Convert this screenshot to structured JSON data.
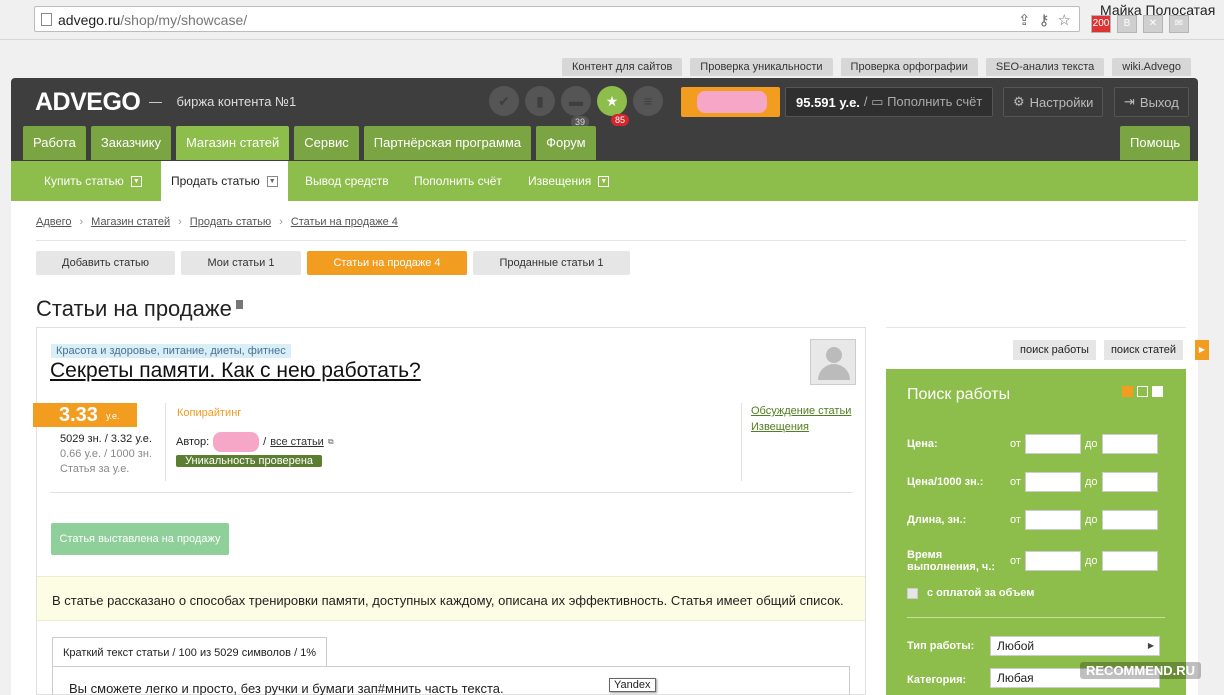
{
  "browser": {
    "url_domain": "advego.ru",
    "url_path": "/shop/my/showcase/",
    "user_name": "Майка Полосатая",
    "ext_badge": "200"
  },
  "top_links": [
    "Контент для сайтов",
    "Проверка уникальности",
    "Проверка орфографии",
    "SEO-анализ текста",
    "wiki.Advego"
  ],
  "header": {
    "logo": "ADVEGO",
    "slogan_dash": "—",
    "slogan": "биржа контента №1",
    "badge_folder": "39",
    "badge_star": "85",
    "balance": "95.591 у.е.",
    "topup": "Пополнить счёт",
    "settings": "Настройки",
    "logout": "Выход"
  },
  "main_nav": [
    "Работа",
    "Заказчику",
    "Магазин статей",
    "Сервис",
    "Партнёрская программа",
    "Форум"
  ],
  "help_tab": "Помощь",
  "sub_nav": {
    "buy": "Купить статью",
    "sell": "Продать статью",
    "withdraw": "Вывод средств",
    "topup": "Пополнить счёт",
    "notices": "Извещения"
  },
  "breadcrumb": [
    "Адвего",
    "Магазин статей",
    "Продать статью",
    "Статьи на продаже 4"
  ],
  "filters": [
    "Добавить статью",
    "Мои статьи 1",
    "Статьи на продаже 4",
    "Проданные статьи 1"
  ],
  "page_title": "Статьи на продаже",
  "article": {
    "category": "Красота и здоровье, питание, диеты, фитнес",
    "title": "Секреты памяти. Как с нею работать?",
    "price": "3.33",
    "price_unit": "у.е.",
    "size_line": "5029 зн. / 3.32 у.е.",
    "per_1000": "0.66 у.е. / 1000 зн.",
    "price_label": "Статья за у.е.",
    "type": "Копирайтинг",
    "author_label": "Автор:",
    "author_sep": "/",
    "all_articles": "все статьи",
    "uniqueness": "Уникальность проверена",
    "discussion": "Обсуждение статьи",
    "notices": "Извещения",
    "status_button": "Статья выставлена на продажу",
    "description": "В статье рассказано о способах тренировки памяти, доступных каждому, описана их эффективность. Статья имеет общий список.",
    "text_tab": "Краткий текст статьи / 100 из 5029 символов / 1%",
    "text_preview": "Вы сможете легко и просто, без ручки и бумаги зап#мнить часть текста.",
    "tooltip": "Yandex"
  },
  "sidebar": {
    "search_jobs_btn": "поиск работы",
    "search_articles_btn": "поиск статей",
    "panel_title": "Поиск работы",
    "from": "от",
    "to": "до",
    "rows": [
      "Цена:",
      "Цена/1000 зн.:",
      "Длина, зн.:",
      "Время выполнения, ч.:"
    ],
    "checkbox": "с оплатой за объем",
    "work_type_label": "Тип работы:",
    "work_type_value": "Любой",
    "category_label": "Категория:",
    "category_value": "Любая"
  },
  "watermark": "RECOMMEND.RU",
  "colors": {
    "green": "#8dbd4a",
    "dark": "#3e3e3e",
    "orange": "#f29c20"
  }
}
